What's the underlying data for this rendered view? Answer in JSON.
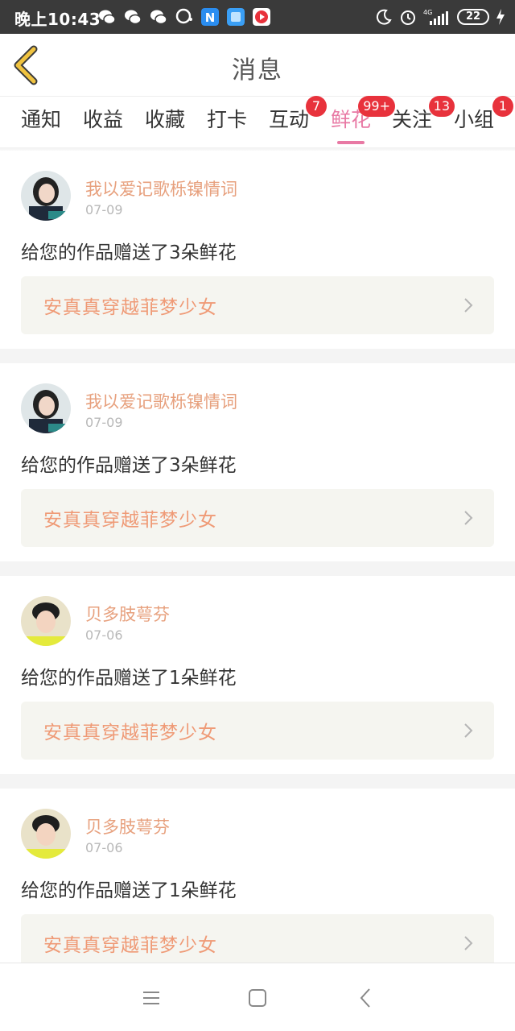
{
  "status_bar": {
    "time": "晚上10:43",
    "network": "4G",
    "battery": "22"
  },
  "header": {
    "title": "消息"
  },
  "tabs": [
    {
      "label": "通知",
      "badge": ""
    },
    {
      "label": "收益",
      "badge": ""
    },
    {
      "label": "收藏",
      "badge": ""
    },
    {
      "label": "打卡",
      "badge": ""
    },
    {
      "label": "互动",
      "badge": "7"
    },
    {
      "label": "鲜花",
      "badge": "99+",
      "active": true
    },
    {
      "label": "关注",
      "badge": "13"
    },
    {
      "label": "小组",
      "badge": "1"
    }
  ],
  "messages": [
    {
      "sender": "我以爱记歌栎镍情词",
      "date": "07-09",
      "text": "给您的作品赠送了3朵鲜花",
      "work": "安真真穿越菲梦少女"
    },
    {
      "sender": "我以爱记歌栎镍情词",
      "date": "07-09",
      "text": "给您的作品赠送了3朵鲜花",
      "work": "安真真穿越菲梦少女"
    },
    {
      "sender": "贝多肢萼芬",
      "date": "07-06",
      "text": "给您的作品赠送了1朵鲜花",
      "work": "安真真穿越菲梦少女"
    },
    {
      "sender": "贝多肢萼芬",
      "date": "07-06",
      "text": "给您的作品赠送了1朵鲜花",
      "work": "安真真穿越菲梦少女"
    }
  ],
  "colors": {
    "accent": "#e879a4",
    "sender": "#e7a07d",
    "work_title": "#ef9a76",
    "badge": "#e8323c",
    "back_arrow": "#f0c340"
  },
  "icons": {
    "back": "chevron-left-icon",
    "menu": "menu-icon",
    "home": "home-icon",
    "nav_back": "back-icon"
  }
}
